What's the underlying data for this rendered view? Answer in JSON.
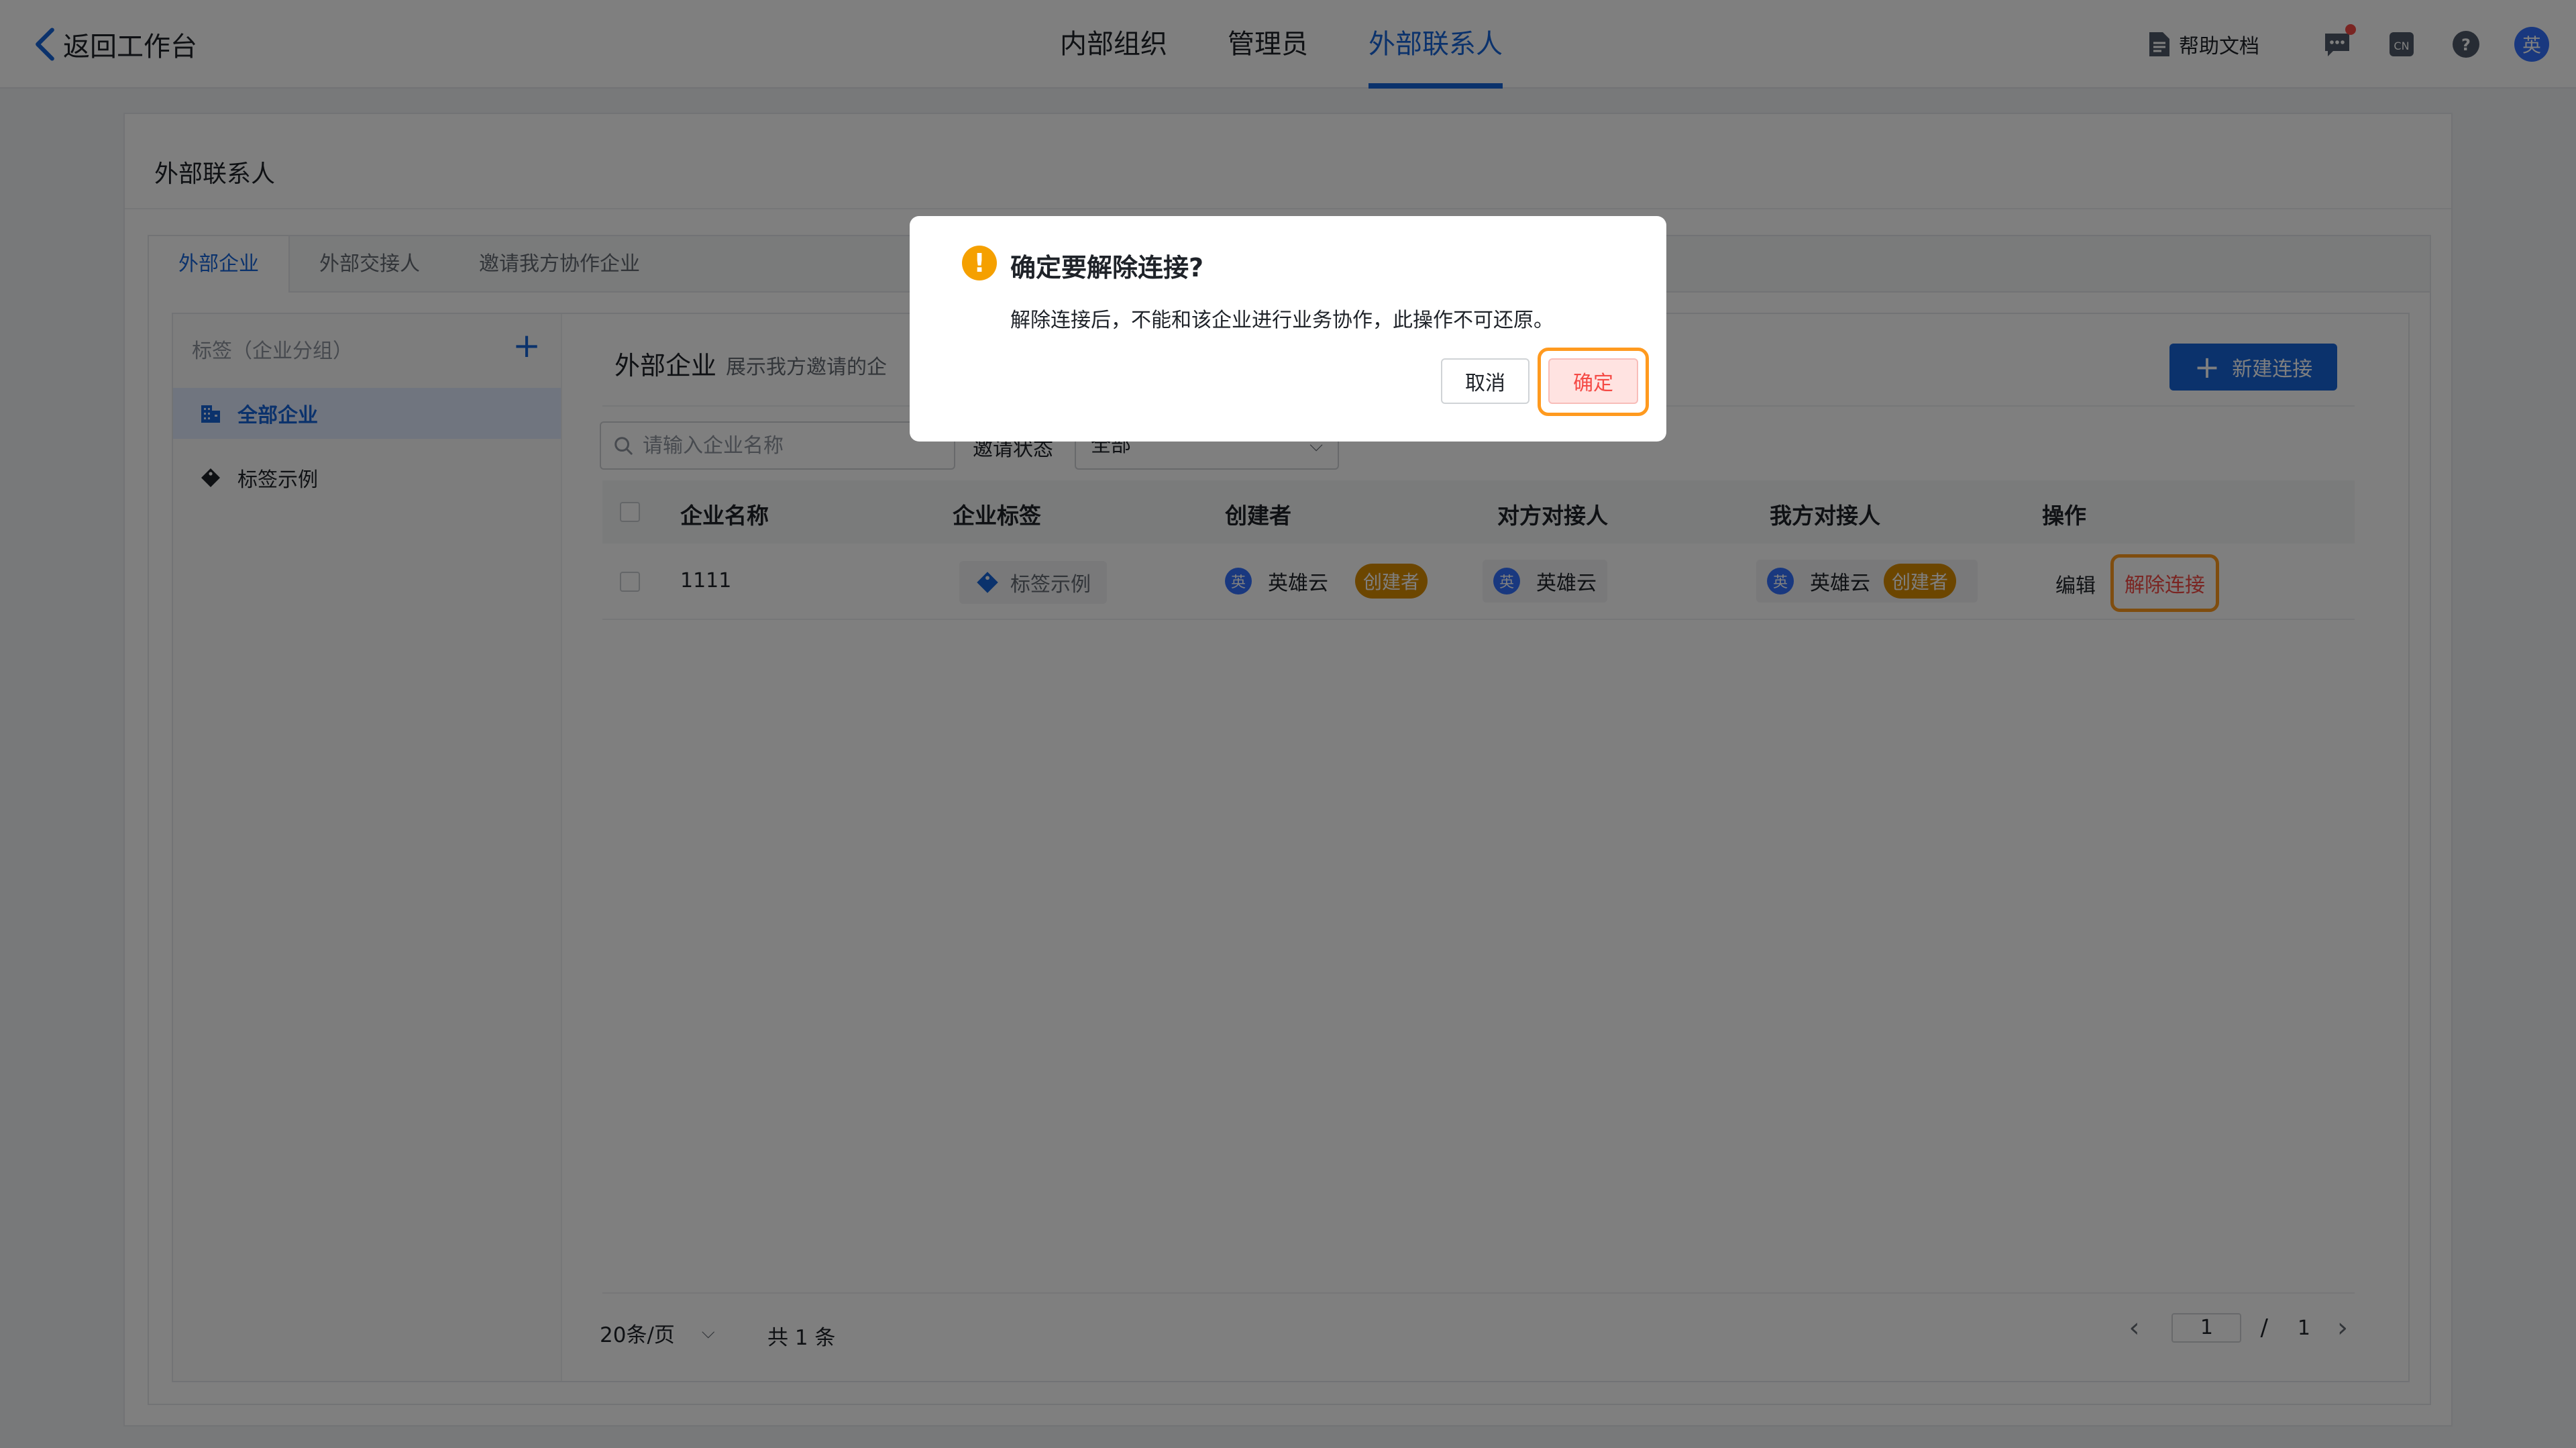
{
  "topbar": {
    "back_label": "返回工作台",
    "nav_tabs": [
      {
        "label": "内部组织",
        "active": false
      },
      {
        "label": "管理员",
        "active": false
      },
      {
        "label": "外部联系人",
        "active": true
      }
    ],
    "help_label": "帮助文档",
    "avatar_initial": "英",
    "icons": [
      "message-icon",
      "language-icon",
      "help-icon"
    ]
  },
  "page": {
    "title": "外部联系人",
    "subtabs": [
      {
        "label": "外部企业",
        "active": true
      },
      {
        "label": "外部交接人",
        "active": false
      },
      {
        "label": "邀请我方协作企业",
        "active": false
      }
    ]
  },
  "sidebar": {
    "header": "标签（企业分组）",
    "add_symbol": "+",
    "items": [
      {
        "label": "全部企业",
        "icon": "building-icon",
        "active": true
      },
      {
        "label": "标签示例",
        "icon": "tag-icon",
        "active": false
      }
    ]
  },
  "main": {
    "title": "外部企业",
    "description": "展示我方邀请的企",
    "new_button": "新建连接",
    "search_placeholder": "请输入企业名称",
    "filter_label": "邀请状态",
    "filter_value": "全部"
  },
  "table": {
    "headers": [
      "企业名称",
      "企业标签",
      "创建者",
      "对方对接人",
      "我方对接人",
      "操作"
    ],
    "rows": [
      {
        "company": "1111",
        "tag": "标签示例",
        "creator": "英雄云",
        "creator_badge": "创建者",
        "their_contact": "英雄云",
        "our_contact": "英雄云",
        "our_badge": "创建者",
        "avatar_initial": "英",
        "op_edit": "编辑",
        "op_unlink": "解除连接"
      }
    ]
  },
  "pagination": {
    "page_size": "20条/页",
    "total": "共 1 条",
    "current_page": "1",
    "separator": "/",
    "total_pages": "1"
  },
  "modal": {
    "icon": "!",
    "title": "确定要解除连接?",
    "description": "解除连接后，不能和该企业进行业务协作，此操作不可还原。",
    "cancel": "取消",
    "confirm": "确定"
  },
  "colors": {
    "primary": "#1664d9",
    "badge": "#d98c00",
    "danger": "#f54a45",
    "warning": "#f5a000",
    "highlight": "#ff9a1f"
  }
}
